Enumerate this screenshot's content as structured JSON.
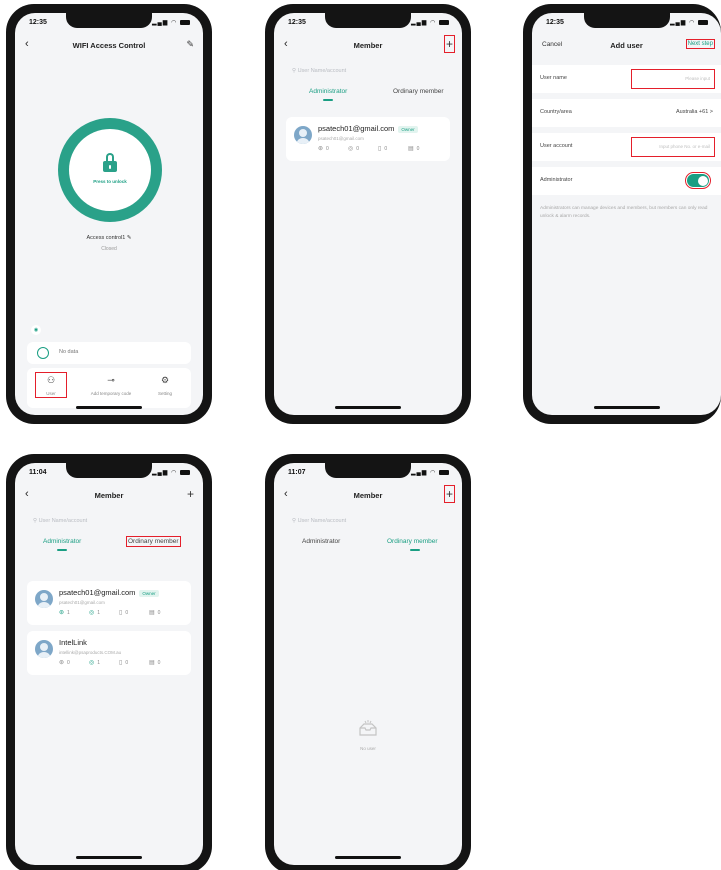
{
  "phone1": {
    "status_time": "12:35",
    "title": "WIFI Access Control",
    "unlock_label": "Press to unlock",
    "device_name": "Access control1",
    "device_state": "Closed",
    "no_data": "No data",
    "bottom": [
      {
        "label": "User"
      },
      {
        "label": "Add temporary code"
      },
      {
        "label": "Setting"
      }
    ]
  },
  "phone2": {
    "status_time": "12:35",
    "title": "Member",
    "add": "+",
    "search_placeholder": "User Name/account",
    "tabs": [
      "Administrator",
      "Ordinary member"
    ],
    "members": [
      {
        "name": "psatech01@gmail.com",
        "badge": "Owner",
        "email": "psatech01@gmail.com",
        "stats": [
          "0",
          "0",
          "0",
          "0"
        ]
      }
    ]
  },
  "phone3": {
    "status_time": "12:35",
    "cancel": "Cancel",
    "title": "Add user",
    "next": "Next step",
    "user_name_label": "User name",
    "user_name_placeholder": "Please input",
    "country_label": "Country/area",
    "country_value": "Australia +61 >",
    "account_label": "User account",
    "account_placeholder": "Input phone No. or e-mail",
    "admin_label": "Administrator",
    "hint": "Administrators can manage devices and members, but members can only read unlock & alarm records."
  },
  "phone4": {
    "status_time": "11:04",
    "title": "Member",
    "add": "+",
    "search_placeholder": "User Name/account",
    "tabs": [
      "Administrator",
      "Ordinary member"
    ],
    "members": [
      {
        "name": "psatech01@gmail.com",
        "badge": "Owner",
        "email": "psatech01@gmail.com",
        "stats": [
          "1",
          "1",
          "0",
          "0"
        ]
      },
      {
        "name": "IntelLink",
        "email": "intellink@psaproducts.COM.au",
        "stats": [
          "0",
          "1",
          "0",
          "0"
        ]
      }
    ]
  },
  "phone5": {
    "status_time": "11:07",
    "title": "Member",
    "add": "+",
    "search_placeholder": "User Name/account",
    "tabs": [
      "Administrator",
      "Ordinary member"
    ],
    "empty_text": "No user"
  },
  "colors": {
    "accent": "#1a9e83",
    "highlight": "#e41f2b",
    "frame": "#141414"
  }
}
